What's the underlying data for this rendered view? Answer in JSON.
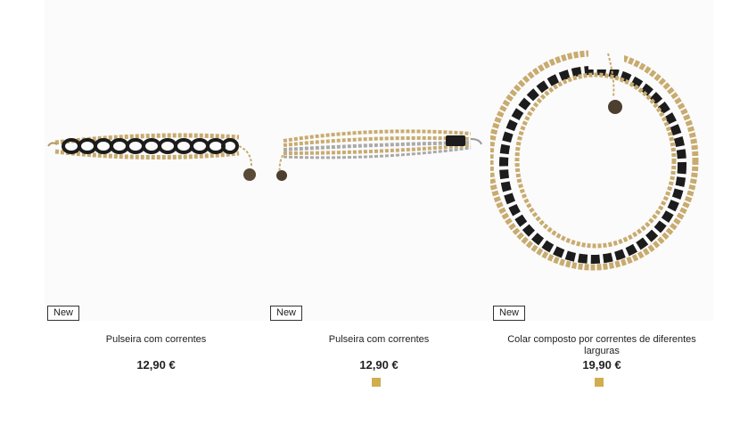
{
  "products": [
    {
      "badge": "New",
      "name": "Pulseira com correntes",
      "price": "12,90 €",
      "image_icon": "chain-bracelet-black-gold"
    },
    {
      "badge": "New",
      "name": "Pulseira com correntes",
      "price": "12,90 €",
      "image_icon": "chain-bracelet-gold-silver",
      "swatch_color": "#d1ad4d"
    },
    {
      "badge": "New",
      "name": "Colar composto por correntes de diferentes larguras",
      "price": "19,90 €",
      "image_icon": "chain-necklace-black-gold",
      "swatch_color": "#d1ad4d"
    }
  ],
  "colors": {
    "gold": "#c7ab72",
    "black_chain": "#1c1c1c",
    "silver": "#a9a9a9",
    "badge_border": "#333333"
  }
}
